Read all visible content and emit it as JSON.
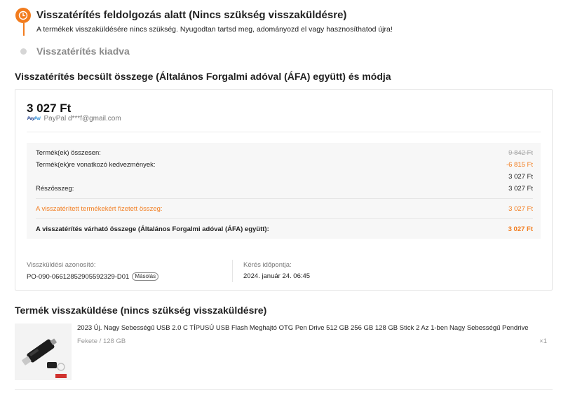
{
  "colors": {
    "accent": "#f27c1e",
    "muted": "#999999",
    "paypal_dark": "#1b3b8b",
    "paypal_light": "#2a8fd8"
  },
  "timeline": {
    "steps": [
      {
        "title": "Visszatérítés feldolgozás alatt (Nincs szükség visszaküldésre)",
        "description": "A termékek visszaküldésére nincs szükség. Nyugodtan tartsd meg, adományozd el vagy hasznosíthatod újra!",
        "icon": "refund-clock-icon",
        "status": "active"
      },
      {
        "title": "Visszatérítés kiadva",
        "status": "pending"
      }
    ]
  },
  "refund_section": {
    "title": "Visszatérítés becsült összege (Általános Forgalmi adóval (ÁFA) együtt) és módja",
    "amount": "3 027 Ft",
    "payment": {
      "logo_text_a": "Pay",
      "logo_text_b": "Pal",
      "label": "PayPal d***f@gmail.com"
    },
    "summary": {
      "products_total_label": "Termék(ek) összesen:",
      "products_total_value": "9 842 Ft",
      "discount_label": "Termék(ek)re vonatkozó kedvezmények:",
      "discount_value": "-6 815 Ft",
      "after_discount_value": "3 027 Ft",
      "subtotal_label": "Részösszeg:",
      "subtotal_value": "3 027 Ft",
      "paid_label": "A visszatérített termékekért fizetett összeg:",
      "paid_value": "3 027 Ft",
      "expected_label": "A visszatérítés várható összege (Általános Forgalmi adóval (ÁFA) együtt):",
      "expected_value": "3 027 Ft"
    },
    "return_id_label": "Visszküldési azonosító:",
    "return_id_value": "PO-090-06612852905592329-D01",
    "copy_label": "Másolás",
    "request_time_label": "Kérés időpontja:",
    "request_time_value": "2024. január 24. 06:45"
  },
  "product_section": {
    "title": "Termék visszaküldése (nincs szükség visszaküldésre)",
    "product": {
      "name": "2023 Új. Nagy Sebességű USB 2.0 C TÍPUSÚ USB Flash Meghajtó OTG Pen Drive 512 GB 256 GB 128 GB Stick 2 Az 1-ben Nagy Sebességű Pendrive",
      "variant": "Fekete / 128 GB",
      "quantity": "×1",
      "image_icon": "usb-flash-drive-image"
    }
  }
}
